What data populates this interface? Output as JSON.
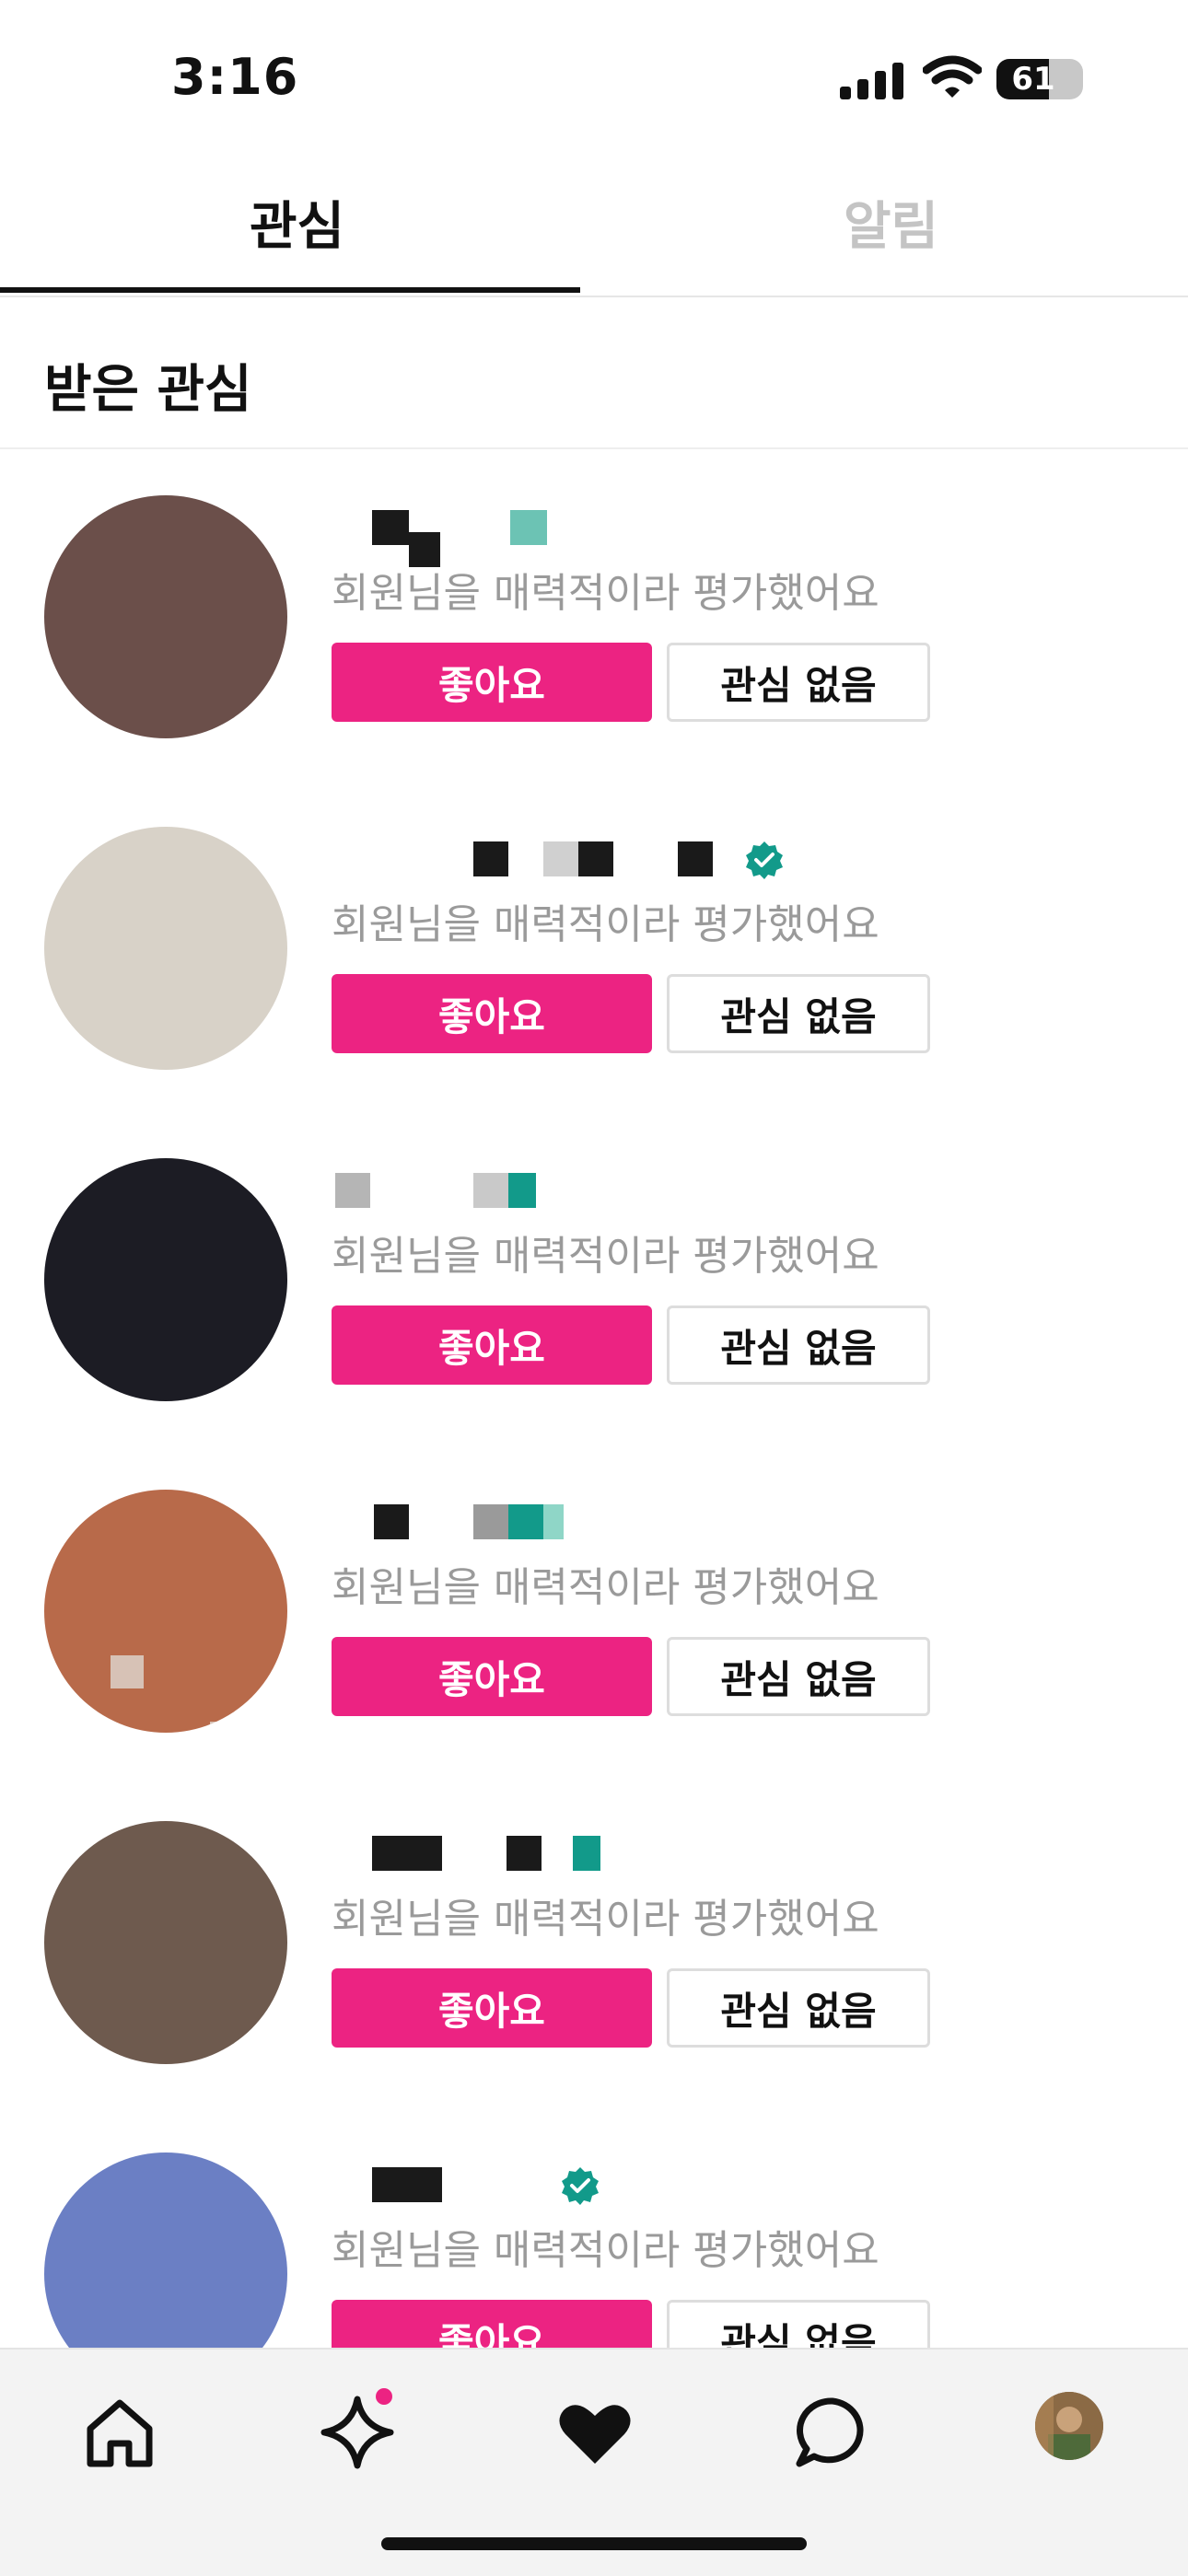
{
  "status_bar": {
    "time": "3:16",
    "battery": "61",
    "battery_level": 0.61
  },
  "tabs": [
    {
      "label": "관심",
      "active": true
    },
    {
      "label": "알림",
      "active": false
    }
  ],
  "section": {
    "title": "받은 관심"
  },
  "list_items": [
    {
      "subtitle": "회원님을 매력적이라 평가했어요",
      "like_label": "좋아요",
      "pass_label": "관심 없음",
      "verified": false
    },
    {
      "subtitle": "회원님을 매력적이라 평가했어요",
      "like_label": "좋아요",
      "pass_label": "관심 없음",
      "verified": true
    },
    {
      "subtitle": "회원님을 매력적이라 평가했어요",
      "like_label": "좋아요",
      "pass_label": "관심 없음",
      "verified": false
    },
    {
      "subtitle": "회원님을 매력적이라 평가했어요",
      "like_label": "좋아요",
      "pass_label": "관심 없음",
      "verified": false
    },
    {
      "subtitle": "회원님을 매력적이라 평가했어요",
      "like_label": "좋아요",
      "pass_label": "관심 없음",
      "verified": false
    },
    {
      "subtitle": "회원님을 매력적이라 평가했어요",
      "like_label": "좋아요",
      "pass_label": "관심 없음",
      "verified": true
    }
  ],
  "bottom_nav": [
    {
      "icon": "home-icon"
    },
    {
      "icon": "sparkle-icon",
      "has_dot": true
    },
    {
      "icon": "heart-icon"
    },
    {
      "icon": "chat-icon"
    },
    {
      "icon": "profile-avatar"
    }
  ],
  "colors": {
    "accent": "#ec2382",
    "verified": "#129a8a",
    "muted": "#9a9a9a"
  }
}
